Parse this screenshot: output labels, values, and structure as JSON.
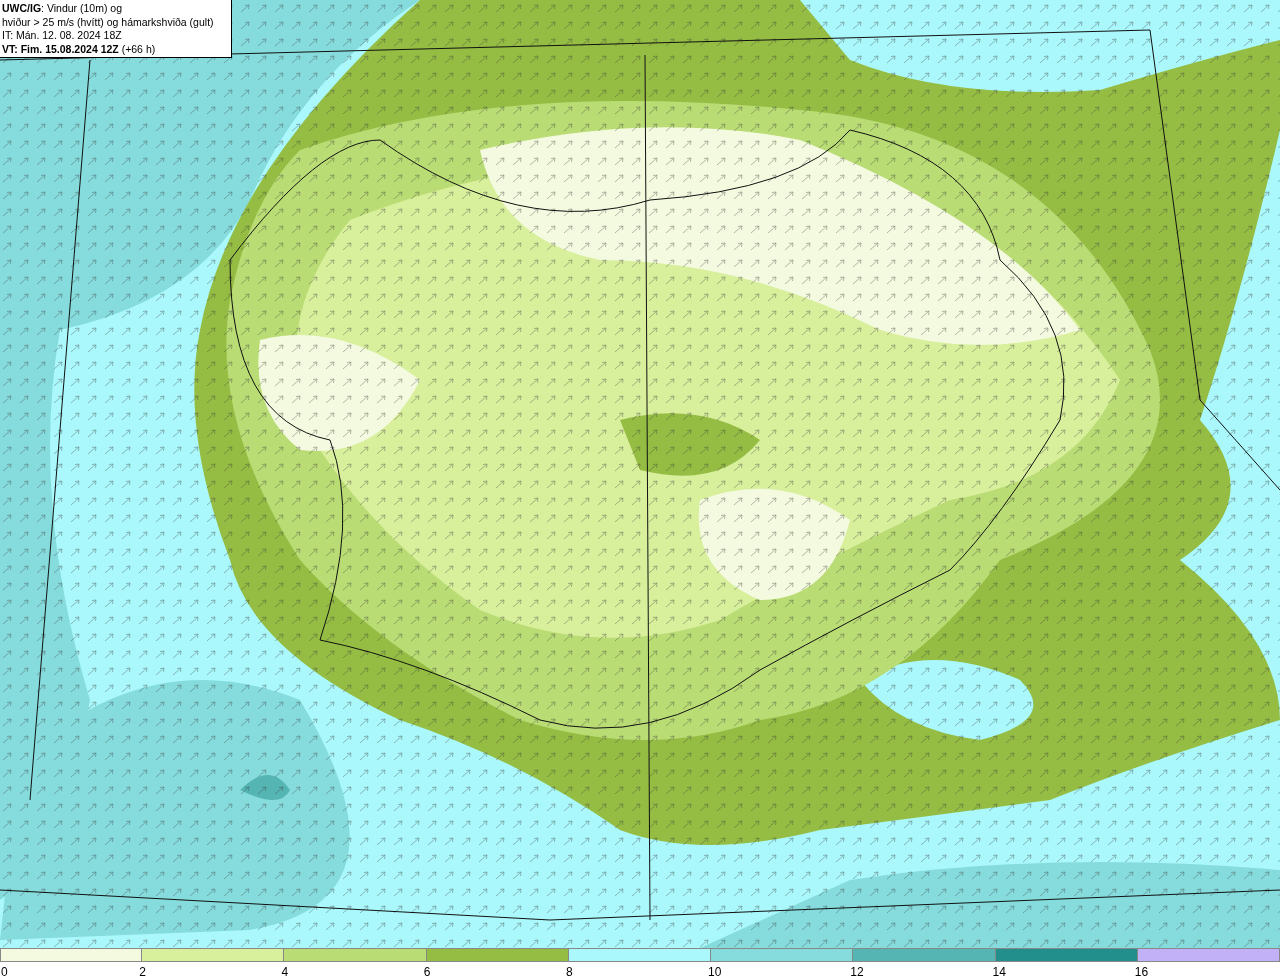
{
  "header": {
    "lines": [
      "**UWC/IG**: Vindur (10m) og",
      "hviður > 25 m/s (hvítt) og hámarkshviða (gult)",
      "IT: Mán. 12. 08. 2024 18Z",
      "**VT: Fim. 15.08.2024 12Z** (+66 h)"
    ]
  },
  "legend": {
    "bins": [
      {
        "color": "#f4fadf",
        "tick": "0"
      },
      {
        "color": "#d8ef9c",
        "tick": "2"
      },
      {
        "color": "#b9dc74",
        "tick": "4"
      },
      {
        "color": "#95bd44",
        "tick": "6"
      },
      {
        "color": "#aaf8fb",
        "tick": "8"
      },
      {
        "color": "#86dcdd",
        "tick": "10"
      },
      {
        "color": "#55b5b3",
        "tick": "12"
      },
      {
        "color": "#238f8d",
        "tick": "14"
      },
      {
        "color": "#c2b1f7",
        "tick": "16"
      }
    ]
  }
}
